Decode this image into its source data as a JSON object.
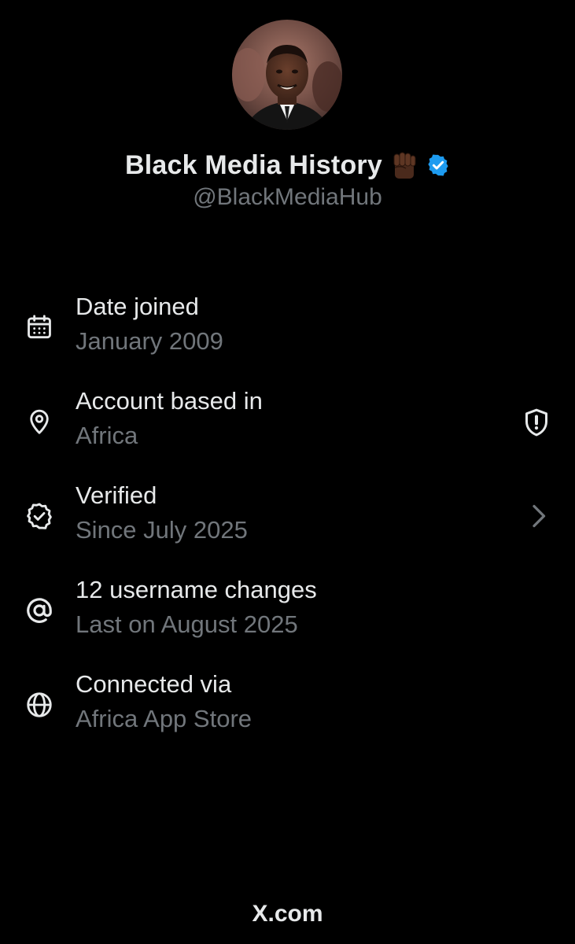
{
  "profile": {
    "display_name": "Black Media History",
    "handle": "@BlackMediaHub",
    "avatar_icon": "profile-photo",
    "name_emoji": "raised-fist-icon",
    "verified_badge_color": "#1d9bf0"
  },
  "info_rows": [
    {
      "icon": "calendar-icon",
      "title": "Date joined",
      "subtitle": "January 2009"
    },
    {
      "icon": "location-pin-icon",
      "title": "Account based in",
      "subtitle": "Africa",
      "trailing_icon": "shield-alert-icon"
    },
    {
      "icon": "verified-check-icon",
      "title": "Verified",
      "subtitle": "Since July 2025",
      "trailing_icon": "chevron-right-icon"
    },
    {
      "icon": "at-sign-icon",
      "title": "12 username changes",
      "subtitle": "Last on August 2025"
    },
    {
      "icon": "globe-icon",
      "title": "Connected via",
      "subtitle": "Africa App Store"
    }
  ],
  "footer": {
    "brand": "X.com"
  },
  "colors": {
    "background": "#000000",
    "primary_text": "#e7e9ea",
    "secondary_text": "#71767b",
    "accent": "#1d9bf0"
  }
}
